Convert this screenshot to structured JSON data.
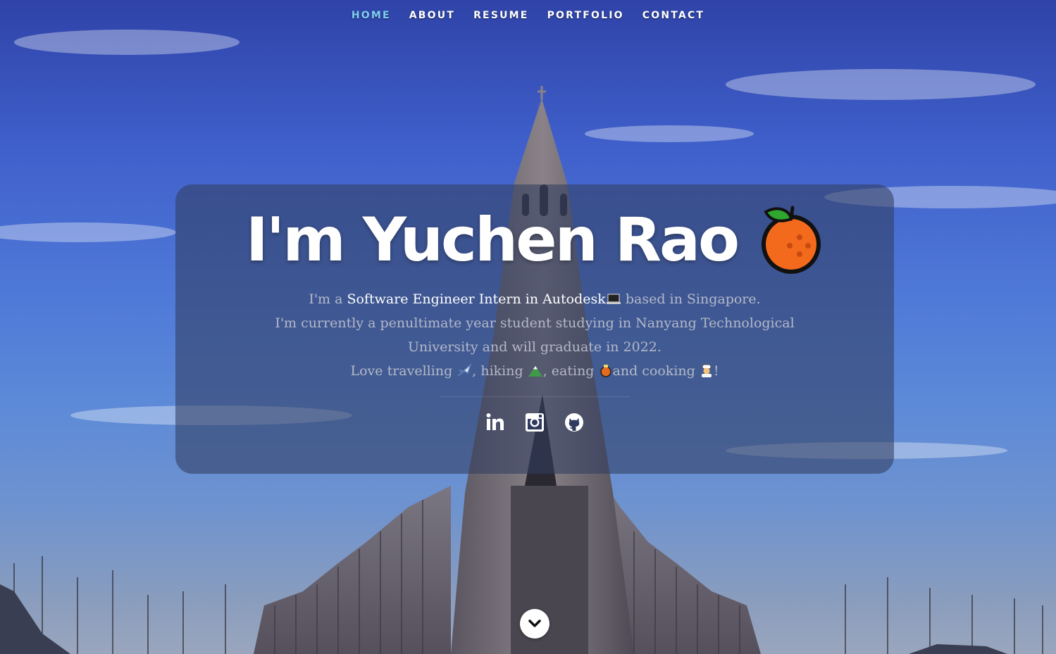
{
  "nav": {
    "items": [
      {
        "label": "HOME",
        "active": true
      },
      {
        "label": "ABOUT",
        "active": false
      },
      {
        "label": "RESUME",
        "active": false
      },
      {
        "label": "PORTFOLIO",
        "active": false
      },
      {
        "label": "CONTACT",
        "active": false
      }
    ],
    "active_color": "#7fd0f0"
  },
  "hero": {
    "title": "I'm Yuchen Rao",
    "title_icon": "orange-emoji-icon",
    "bio": {
      "line1_pre": "I'm a ",
      "line1_highlight": "Software Engineer Intern in Autodesk",
      "line1_icon": "laptop-emoji-icon",
      "line1_post": " based in Singapore.",
      "line2": "I'm currently a penultimate year student studying in Nanyang Technological University and will graduate in 2022.",
      "line3_a": "Love travelling ",
      "line3_icon_a": "airplane-emoji-icon",
      "line3_b": ", hiking ",
      "line3_icon_b": "mountain-emoji-icon",
      "line3_c": ", eating ",
      "line3_icon_c": "food-emoji-icon",
      "line3_d": "and cooking ",
      "line3_icon_d": "cook-emoji-icon",
      "line3_e": "!"
    },
    "socials": [
      {
        "icon": "linkedin-icon"
      },
      {
        "icon": "instagram-icon"
      },
      {
        "icon": "github-icon"
      }
    ]
  },
  "scroll_down": {
    "icon": "chevron-down-icon"
  }
}
